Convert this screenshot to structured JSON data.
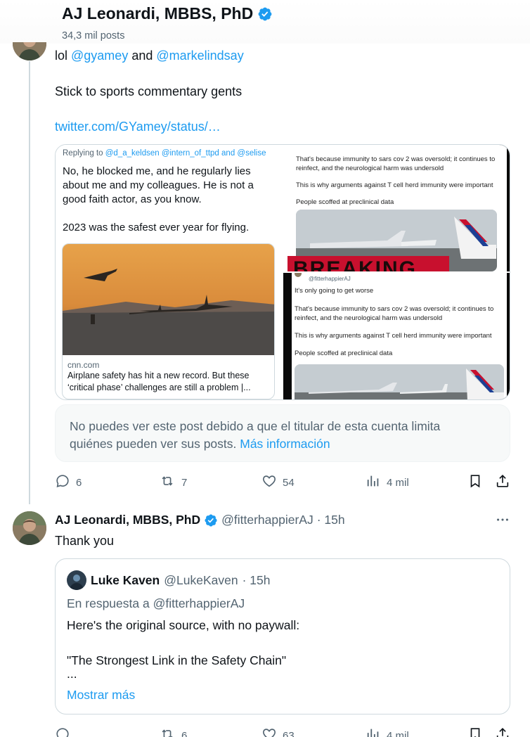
{
  "header": {
    "name": "AJ Leonardi, MBBS, PhD",
    "post_count": "34,3 mil posts"
  },
  "post1": {
    "line1_prefix": "lol ",
    "mention1": "@gyamey",
    "line1_mid": " and ",
    "mention2": "@markelindsay",
    "line2": "Stick to sports commentary gents",
    "link": "twitter.com/GYamey/status/…",
    "embedded": {
      "replying_prefix": "Replying to ",
      "replying_handles": "@d_a_keldsen @intern_of_ttpd and @selise",
      "body1": "No, he blocked me, and he regularly lies",
      "body2": "about me and my colleagues. He is not a",
      "body3": "good faith actor, as you know.",
      "body4": "2023 was the safest ever year for flying.",
      "card_domain": "cnn.com",
      "card_title1": "Airplane safety has hit a new record. But these",
      "card_title2": "‘critical phase’ challenges are still a problem |..."
    },
    "shot_top": {
      "l1": "That's because immunity to sars cov 2 was oversold; it continues to",
      "l2": "reinfect, and the neurological harm was undersold",
      "l3": "This is why arguments against T cell herd immunity were important",
      "l4": "People scoffed at preclinical data",
      "banner": "BREAKING"
    },
    "shot_bottom": {
      "handle": "@fitterhappierAJ",
      "l0": "It's only going to get worse",
      "l1": "That's because immunity to sars cov 2 was oversold; it continues to",
      "l2": "reinfect, and the neurological harm was undersold",
      "l3": "This is why arguments against T cell herd immunity were important",
      "l4": "People scoffed at preclinical data"
    },
    "restricted_text1": "No puedes ver este post debido a que el titular de esta cuenta limita",
    "restricted_text2": "quiénes pueden ver sus posts. ",
    "restricted_link": "Más información",
    "replies": "6",
    "reposts": "7",
    "likes": "54",
    "views": "4 mil"
  },
  "post2": {
    "name": "AJ Leonardi, MBBS, PhD",
    "handle": "@fitterhappierAJ",
    "time": "· 15h",
    "text": "Thank you",
    "quote": {
      "name": "Luke Kaven",
      "handle": "@LukeKaven",
      "time": "· 15h",
      "reply_to": "En respuesta a @fitterhappierAJ",
      "line1": "Here's the original source, with no paywall:",
      "line2": "\"The Strongest Link in the Safety Chain\"",
      "line3": "...",
      "show_more": "Mostrar más"
    },
    "replies": "",
    "reposts": "6",
    "likes": "63",
    "views": "4 mil"
  },
  "colors": {
    "accent": "#1d9bf0",
    "text": "#0f1419",
    "muted": "#536471",
    "border": "#cfd9de"
  }
}
